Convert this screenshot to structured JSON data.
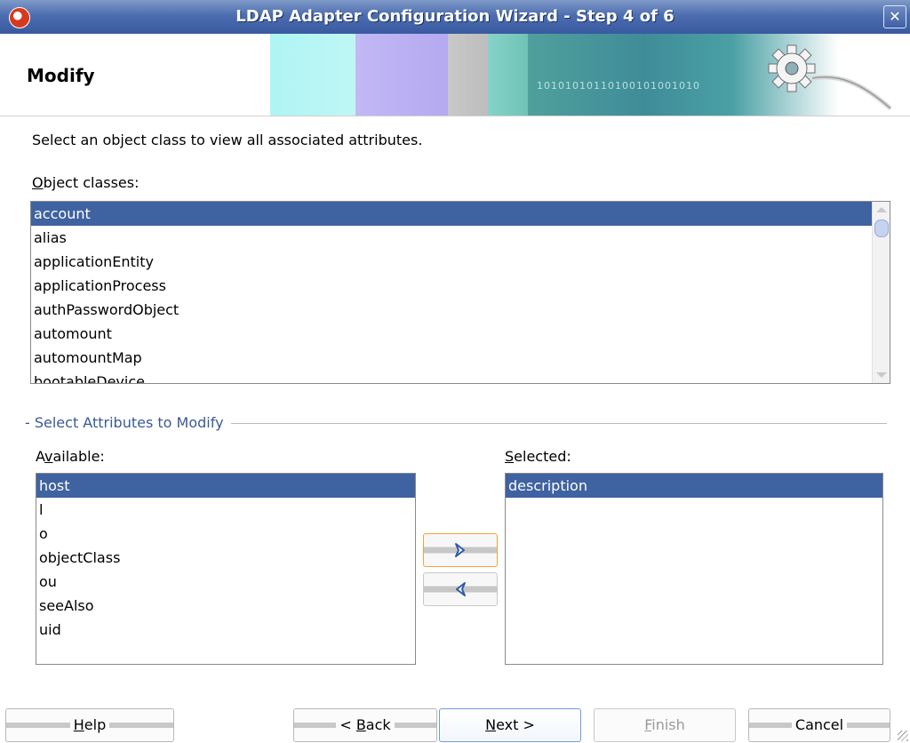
{
  "window": {
    "title": "LDAP Adapter Configuration Wizard - Step 4 of 6",
    "close_glyph": "✕",
    "app_icon": "oracle-logo-icon"
  },
  "header": {
    "heading": "Modify",
    "banner_digits": "10101010110100101001010"
  },
  "main": {
    "instruction": "Select an object class to view all associated attributes.",
    "object_classes_label_accel": "O",
    "object_classes_label_rest": "bject classes:",
    "object_classes": [
      "account",
      "alias",
      "applicationEntity",
      "applicationProcess",
      "authPasswordObject",
      "automount",
      "automountMap",
      "bootableDevice"
    ],
    "object_classes_selected": "account",
    "section_title": "- Select Attributes to Modify",
    "available_label_pre": "A",
    "available_label_accel": "v",
    "available_label_rest": "ailable:",
    "available": [
      "host",
      "l",
      "o",
      "objectClass",
      "ou",
      "seeAlso",
      "uid"
    ],
    "available_selected": "host",
    "selected_label_accel": "S",
    "selected_label_rest": "elected:",
    "selected": [
      "description"
    ],
    "selected_selected": "description",
    "add_icon": "chevron-right-icon",
    "remove_icon": "chevron-left-icon"
  },
  "buttons": {
    "help_accel": "H",
    "help_rest": "elp",
    "back_pre": "< ",
    "back_accel": "B",
    "back_rest": "ack",
    "next_accel": "N",
    "next_rest": "ext >",
    "finish_accel": "F",
    "finish_rest": "inish",
    "cancel": "Cancel"
  },
  "colors": {
    "selection": "#3f62a0",
    "title_bar": "#4c6db0",
    "section_title": "#3a5a96",
    "focus_border": "#f0a33a"
  }
}
